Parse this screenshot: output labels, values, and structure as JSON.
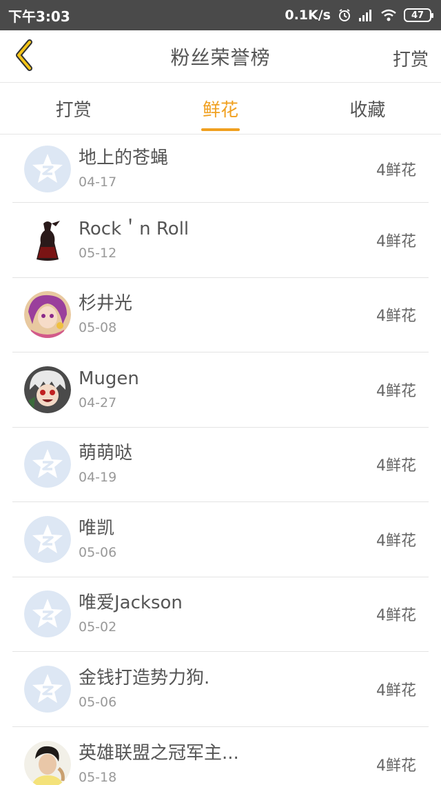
{
  "status_bar": {
    "time": "下午3:03",
    "speed": "0.1K/s",
    "battery": "47",
    "icons": [
      "alarm-icon",
      "signal-icon",
      "wifi-icon",
      "battery-icon"
    ]
  },
  "header": {
    "title": "粉丝荣誉榜",
    "action_label": "打赏",
    "back_icon": "chevron-left-icon"
  },
  "tabs": [
    {
      "label": "打赏",
      "active": false
    },
    {
      "label": "鲜花",
      "active": true
    },
    {
      "label": "收藏",
      "active": false
    }
  ],
  "colors": {
    "accent": "#f0a020",
    "status_bar": "#4a4a4a",
    "default_avatar": "#dde7f4"
  },
  "fans": [
    {
      "name": "地上的苍蝇",
      "date": "04-17",
      "count": "4鲜花",
      "avatar": "default-avatar-icon"
    },
    {
      "name": "Rock＇n Roll",
      "date": "05-12",
      "count": "4鲜花",
      "avatar": "dark-figure-avatar"
    },
    {
      "name": "杉井光",
      "date": "05-08",
      "count": "4鲜花",
      "avatar": "anime-girl-avatar"
    },
    {
      "name": "Mugen",
      "date": "04-27",
      "count": "4鲜花",
      "avatar": "anime-boy-avatar"
    },
    {
      "name": "萌萌哒",
      "date": "04-19",
      "count": "4鲜花",
      "avatar": "default-avatar-icon"
    },
    {
      "name": "唯凯",
      "date": "05-06",
      "count": "4鲜花",
      "avatar": "default-avatar-icon"
    },
    {
      "name": "唯爱Jackson",
      "date": "05-02",
      "count": "4鲜花",
      "avatar": "default-avatar-icon"
    },
    {
      "name": "金钱打造势力狗.",
      "date": "05-06",
      "count": "4鲜花",
      "avatar": "default-avatar-icon"
    },
    {
      "name": "英雄联盟之冠军主...",
      "date": "05-18",
      "count": "4鲜花",
      "avatar": "person-photo-avatar"
    }
  ]
}
